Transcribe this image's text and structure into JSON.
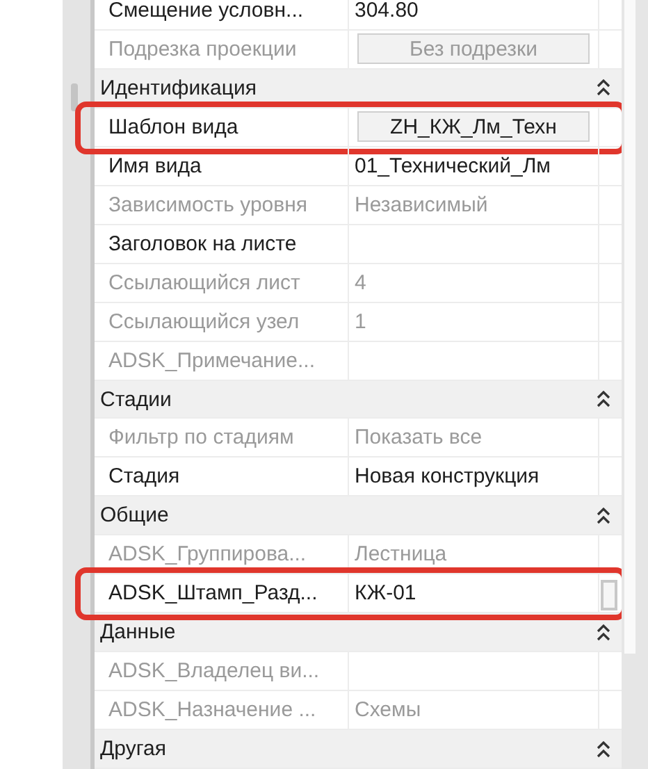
{
  "properties": [
    {
      "kind": "text_row",
      "label": "Смещение условн...",
      "value": "304.80",
      "disabled": false,
      "highlighted": false
    },
    {
      "kind": "button_row",
      "label": "Подрезка проекции",
      "value": "Без подрезки",
      "disabled": true,
      "highlighted": false
    },
    {
      "kind": "group",
      "label": "Идентификация",
      "expanded": true
    },
    {
      "kind": "button_row",
      "label": "Шаблон вида",
      "value": "ZH_КЖ_Лм_Техн",
      "disabled": false,
      "highlighted": true
    },
    {
      "kind": "text_row",
      "label": "Имя вида",
      "value": "01_Технический_Лм",
      "disabled": false,
      "highlighted": false
    },
    {
      "kind": "text_row",
      "label": "Зависимость уровня",
      "value": "Независимый",
      "disabled": true,
      "highlighted": false
    },
    {
      "kind": "text_row",
      "label": "Заголовок на листе",
      "disabled": false,
      "highlighted": false
    },
    {
      "kind": "text_row",
      "label": "Ссылающийся лист",
      "value": "4",
      "disabled": true,
      "highlighted": false
    },
    {
      "kind": "text_row",
      "label": "Ссылающийся узел",
      "value": "1",
      "disabled": true,
      "highlighted": false
    },
    {
      "kind": "text_row",
      "label": "ADSK_Примечание...",
      "disabled": true,
      "highlighted": false
    },
    {
      "kind": "group",
      "label": "Стадии",
      "expanded": true
    },
    {
      "kind": "text_row",
      "label": "Фильтр по стадиям",
      "value": "Показать все",
      "disabled": true,
      "highlighted": false
    },
    {
      "kind": "text_row",
      "label": "Стадия",
      "value": "Новая конструкция",
      "disabled": false,
      "highlighted": false
    },
    {
      "kind": "group",
      "label": "Общие",
      "expanded": true
    },
    {
      "kind": "text_row",
      "label": "ADSK_Группирова...",
      "value": "Лестница",
      "disabled": true,
      "highlighted": false
    },
    {
      "kind": "edit_row",
      "label": "ADSK_Штамп_Разд...",
      "value": "КЖ-01",
      "disabled": false,
      "highlighted": true
    },
    {
      "kind": "group",
      "label": "Данные",
      "expanded": true
    },
    {
      "kind": "text_row",
      "label": "ADSK_Владелец ви...",
      "disabled": true,
      "highlighted": false
    },
    {
      "kind": "text_row",
      "label": "ADSK_Назначение ...",
      "value": "Схемы",
      "disabled": true,
      "highlighted": false
    },
    {
      "kind": "group",
      "label": "Другая",
      "expanded": true
    }
  ]
}
